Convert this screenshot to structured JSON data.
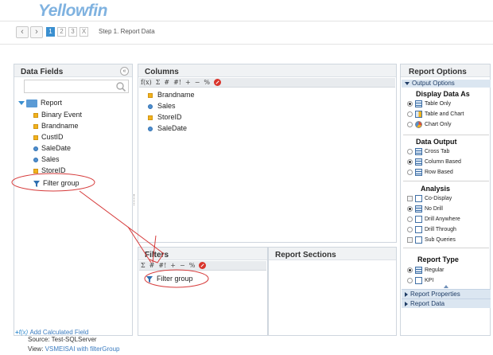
{
  "header": {
    "logo_text": "Yellowfin"
  },
  "stepbar": {
    "back_label": "‹",
    "forward_label": "›",
    "steps": [
      "1",
      "2",
      "3",
      "X"
    ],
    "title": "Step 1. Report Data"
  },
  "data_fields": {
    "title": "Data Fields",
    "collapse_label": "«",
    "search": {
      "value": "",
      "placeholder": ""
    },
    "tree": {
      "root": "Report",
      "items": [
        {
          "label": "Binary Event",
          "kind": "dimension"
        },
        {
          "label": "Brandname",
          "kind": "dimension"
        },
        {
          "label": "CustID",
          "kind": "dimension"
        },
        {
          "label": "SaleDate",
          "kind": "metric"
        },
        {
          "label": "Sales",
          "kind": "metric"
        },
        {
          "label": "StoreID",
          "kind": "dimension"
        },
        {
          "label": "Filter group",
          "kind": "filter"
        }
      ]
    },
    "add_calculated_field": "Add Calculated Field"
  },
  "columns": {
    "title": "Columns",
    "toolbar": [
      "f(x)",
      "Σ",
      "#",
      "#!",
      "+",
      "−",
      "%"
    ],
    "items": [
      {
        "label": "Brandname",
        "kind": "dimension"
      },
      {
        "label": "Sales",
        "kind": "metric"
      },
      {
        "label": "StoreID",
        "kind": "dimension"
      },
      {
        "label": "SaleDate",
        "kind": "metric"
      }
    ]
  },
  "filters": {
    "title": "Filters",
    "toolbar": [
      "Σ",
      "#",
      "#!",
      "+",
      "−",
      "%"
    ],
    "items": [
      {
        "label": "Filter group"
      }
    ]
  },
  "report_sections": {
    "title": "Report Sections"
  },
  "report_options": {
    "title": "Report Options",
    "output_options_label": "Output Options",
    "display_data_as": {
      "title": "Display Data As",
      "options": [
        {
          "label": "Table Only",
          "selected": true,
          "icon": "table-icon"
        },
        {
          "label": "Table and Chart",
          "selected": false,
          "icon": "table-chart-icon"
        },
        {
          "label": "Chart Only",
          "selected": false,
          "icon": "pie-chart-icon"
        }
      ]
    },
    "data_output": {
      "title": "Data Output",
      "options": [
        {
          "label": "Cross Tab",
          "selected": false,
          "icon": "crosstab-icon"
        },
        {
          "label": "Column Based",
          "selected": true,
          "icon": "column-icon"
        },
        {
          "label": "Row Based",
          "selected": false,
          "icon": "row-icon"
        }
      ]
    },
    "analysis": {
      "title": "Analysis",
      "options": [
        {
          "label": "Co-Display",
          "type": "checkbox",
          "selected": false
        },
        {
          "label": "No Drill",
          "type": "radio",
          "selected": true
        },
        {
          "label": "Drill Anywhere",
          "type": "radio",
          "selected": false
        },
        {
          "label": "Drill Through",
          "type": "radio",
          "selected": false
        },
        {
          "label": "Sub Queries",
          "type": "checkbox",
          "selected": false
        }
      ]
    },
    "report_type": {
      "title": "Report Type",
      "options": [
        {
          "label": "Regular",
          "selected": true
        },
        {
          "label": "KPI",
          "selected": false
        }
      ]
    },
    "report_properties_label": "Report Properties",
    "report_data_label": "Report Data"
  },
  "source_info": {
    "source_label": "Source:",
    "source_value": "Test-SQLServer",
    "view_label": "View:",
    "view_value": "VSMEISAI with filterGroup"
  },
  "colors": {
    "brand_blue": "#3a8fd0",
    "dimension_yellow": "#f2b21c",
    "annotation_red": "#d63a3a",
    "panel_border": "#cfd6de"
  }
}
